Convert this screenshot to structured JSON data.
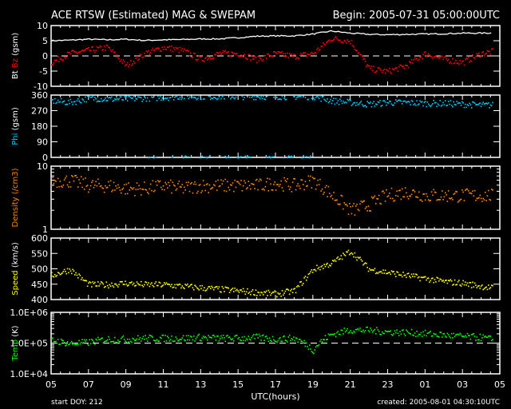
{
  "chart_data": [
    {
      "type": "scatter",
      "title": "ACE RTSW (Estimated) MAG & SWEPAM",
      "begin": "Begin: 2005-07-31 05:00:00UTC",
      "x_hours_from_start": [
        0,
        1,
        2,
        3,
        4,
        5,
        6,
        7,
        8,
        9,
        10,
        11,
        12,
        13,
        14,
        15,
        16,
        17,
        18,
        19,
        20,
        21,
        22,
        23,
        24
      ],
      "xlabel": "UTC(hours)",
      "x_tick_labels": [
        "05",
        "07",
        "09",
        "11",
        "13",
        "15",
        "17",
        "19",
        "21",
        "23",
        "01",
        "03",
        "05"
      ],
      "start_doy": "start DOY: 212",
      "created": "created: 2005-08-01 04:30:10UTC",
      "panels": [
        {
          "id": "mag",
          "ylabel_parts": [
            "Bt",
            "Bz",
            "(gsm)"
          ],
          "ylabel_colors": [
            "#ffffff",
            "#ff0000",
            "#ffffff"
          ],
          "scale": "linear",
          "ylim": [
            -10,
            10
          ],
          "ticks": [
            "10",
            "5",
            "0",
            "-5",
            "-10"
          ],
          "tick_values": [
            10,
            5,
            0,
            -5,
            -10
          ],
          "dashed_line": 0,
          "series": [
            {
              "name": "Bt",
              "color": "#ffffff",
              "style": "line",
              "values": [
                5,
                5.2,
                5.5,
                5.3,
                5.5,
                5.1,
                5.3,
                5.4,
                5.6,
                5.6,
                6.0,
                6.5,
                6.6,
                6.6,
                7.2,
                8.2,
                7.5,
                7.1,
                7.0,
                7.1,
                7.2,
                7.3,
                7.5,
                7.5,
                7.6
              ]
            },
            {
              "name": "Bz",
              "color": "#ff0000",
              "style": "dots",
              "values": [
                -2,
                1,
                2,
                3,
                -3,
                1,
                3,
                2,
                -1,
                1,
                1,
                -1,
                1,
                0,
                1,
                6,
                5,
                -4,
                -5,
                -3,
                1,
                -1,
                -2,
                1,
                2
              ]
            }
          ]
        },
        {
          "id": "phi",
          "ylabel_parts": [
            "Phi",
            "(gsm)"
          ],
          "ylabel_colors": [
            "#00ccff",
            "#ffffff"
          ],
          "scale": "linear",
          "ylim": [
            0,
            360
          ],
          "ticks": [
            "360",
            "270",
            "180",
            "90",
            "0"
          ],
          "tick_values": [
            360,
            270,
            180,
            90,
            0
          ],
          "series": [
            {
              "name": "Phi",
              "color": "#00ccff",
              "style": "dots",
              "values": [
                330,
                320,
                345,
                340,
                340,
                345,
                350,
                355,
                355,
                355,
                355,
                355,
                355,
                355,
                355,
                330,
                320,
                310,
                320,
                320,
                315,
                315,
                310,
                305,
                305
              ]
            }
          ]
        },
        {
          "id": "density",
          "ylabel_parts": [
            "Density (/cm3)"
          ],
          "ylabel_colors": [
            "#ff8800"
          ],
          "scale": "log",
          "ylim": [
            1,
            10
          ],
          "ticks": [
            "10",
            "1"
          ],
          "tick_values": [
            10,
            1
          ],
          "series": [
            {
              "name": "Density",
              "color": "#ff8800",
              "style": "dots",
              "values": [
                6,
                6,
                5,
                5,
                4.5,
                4.5,
                5,
                4.5,
                5,
                5,
                5,
                5,
                5.5,
                5,
                6,
                3.5,
                2,
                2.5,
                3.5,
                4,
                3.5,
                3.5,
                3.5,
                3.5,
                3.5
              ]
            }
          ]
        },
        {
          "id": "speed",
          "ylabel_parts": [
            "Speed",
            "(km/s)"
          ],
          "ylabel_colors": [
            "#ffff00",
            "#ffffff"
          ],
          "scale": "linear",
          "ylim": [
            400,
            600
          ],
          "ticks": [
            "600",
            "550",
            "500",
            "450",
            "400"
          ],
          "tick_values": [
            600,
            550,
            500,
            450,
            400
          ],
          "series": [
            {
              "name": "Speed",
              "color": "#ffff00",
              "style": "dots",
              "values": [
                480,
                500,
                450,
                450,
                455,
                450,
                450,
                445,
                440,
                435,
                430,
                425,
                420,
                430,
                500,
                520,
                560,
                500,
                490,
                480,
                470,
                460,
                455,
                445,
                435
              ]
            }
          ]
        },
        {
          "id": "temp",
          "ylabel_parts": [
            "Temp",
            "(K)"
          ],
          "ylabel_colors": [
            "#00ff00",
            "#ffffff"
          ],
          "scale": "log",
          "ylim": [
            10000,
            1000000
          ],
          "ticks": [
            "1.0E+06",
            "1.0E+05",
            "1.0E+04"
          ],
          "tick_values": [
            1000000,
            100000,
            10000
          ],
          "dashed_line": 100000,
          "series": [
            {
              "name": "Temp",
              "color": "#00ff00",
              "style": "dots",
              "values": [
                130000,
                100000,
                110000,
                140000,
                140000,
                150000,
                150000,
                150000,
                160000,
                150000,
                150000,
                160000,
                140000,
                150000,
                60000,
                200000,
                280000,
                270000,
                240000,
                230000,
                210000,
                190000,
                170000,
                160000,
                120000
              ]
            }
          ]
        }
      ]
    }
  ]
}
